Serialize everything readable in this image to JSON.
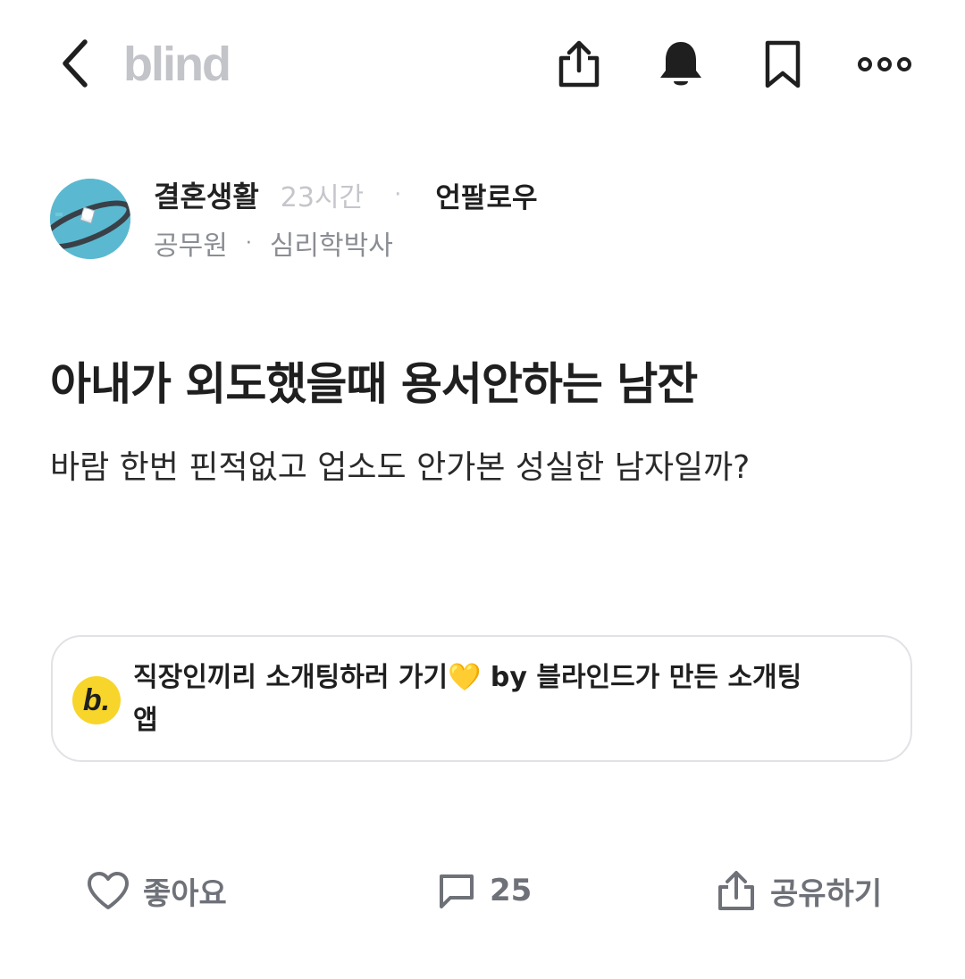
{
  "header": {
    "logo": "blind",
    "back_icon": "chevron-left-icon",
    "share_icon": "share-upload-icon",
    "bell_icon": "bell-icon",
    "bookmark_icon": "bookmark-icon",
    "more_icon": "more-dots-icon"
  },
  "author": {
    "channel": "결혼생활",
    "time_ago": "23시간",
    "separator": "·",
    "follow_action": "언팔로우",
    "job": "공무원",
    "nickname": "심리학박사"
  },
  "post": {
    "title": "아내가 외도했을때 용서안하는 남잔",
    "body": "바람 한번 핀적없고 업소도 안가본 성실한 남자일까?"
  },
  "ad": {
    "logo_letter": "b.",
    "text": "직장인끼리 소개팅하러 가기💛 by 블라인드가 만든 소개팅앱"
  },
  "actions": {
    "like_label": "좋아요",
    "comment_count": "25",
    "share_label": "공유하기"
  },
  "colors": {
    "logo_gray": "#c2c4c9",
    "ad_yellow": "#f7d52a",
    "action_gray": "#6e7178"
  }
}
